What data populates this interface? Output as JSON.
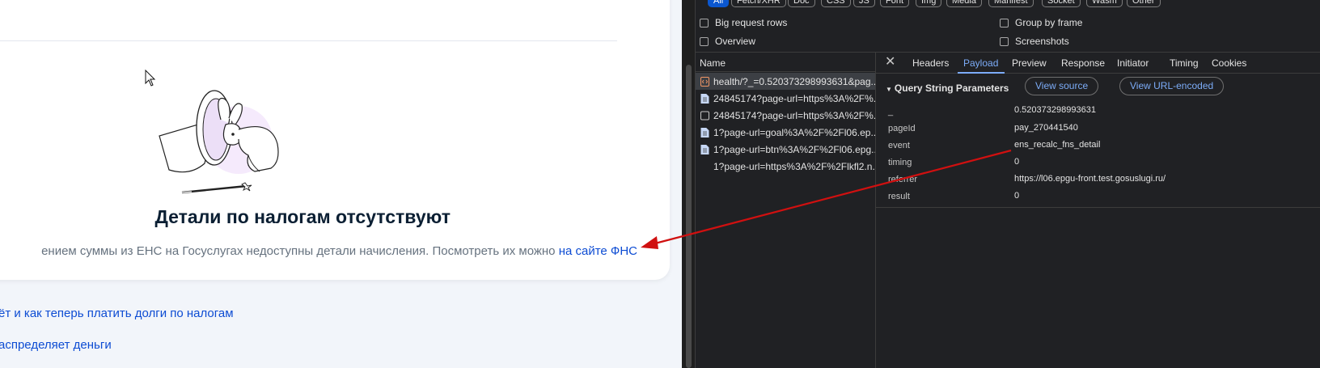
{
  "webpage": {
    "empty_state": {
      "title": "Детали по налогам отсутствуют",
      "description": "ением суммы из ЕНС на Госуслугах недоступны детали начисления. Посмотреть их можно",
      "link_text": "на сайте ФНС"
    },
    "links": [
      "ёт и как теперь платить долги по налогам",
      "аспределяет деньги"
    ]
  },
  "devtools": {
    "filter_chips": [
      "All",
      "Fetch/XHR",
      "Doc",
      "CSS",
      "JS",
      "Font",
      "Img",
      "Media",
      "Manifest",
      "Socket",
      "Wasm",
      "Other"
    ],
    "options": {
      "big_request_rows": "Big request rows",
      "group_by_frame": "Group by frame",
      "overview": "Overview",
      "screenshots": "Screenshots"
    },
    "request_list": {
      "header": "Name",
      "rows": [
        {
          "name": "health/?_=0.520373298993631&pag...",
          "icon": "xhr-icon"
        },
        {
          "name": "24845174?page-url=https%3A%2F%...",
          "icon": "document-icon"
        },
        {
          "name": "24845174?page-url=https%3A%2F%...",
          "icon": "checkbox-icon"
        },
        {
          "name": "1?page-url=goal%3A%2F%2Fl06.ep...",
          "icon": "document-icon"
        },
        {
          "name": "1?page-url=btn%3A%2F%2Fl06.epg...",
          "icon": "document-icon"
        },
        {
          "name": "1?page-url=https%3A%2F%2Flkfl2.n...",
          "icon": "none"
        }
      ]
    },
    "detail_tabs": [
      "Headers",
      "Payload",
      "Preview",
      "Response",
      "Initiator",
      "Timing",
      "Cookies"
    ],
    "active_tab": "Payload",
    "query_string": {
      "title": "Query String Parameters",
      "view_source_label": "View source",
      "view_url_encoded_label": "View URL-encoded",
      "params": [
        {
          "key": "_",
          "value": "0.520373298993631"
        },
        {
          "key": "pageId",
          "value": "pay_270441540"
        },
        {
          "key": "event",
          "value": "ens_recalc_fns_detail"
        },
        {
          "key": "timing",
          "value": "0"
        },
        {
          "key": "referrer",
          "value": "https://l06.epgu-front.test.gosuslugi.ru/"
        },
        {
          "key": "result",
          "value": "0"
        }
      ]
    }
  },
  "colors": {
    "link_blue": "#0d4cd3",
    "devtools_bg": "#202124",
    "active_tab": "#7cacf8",
    "annotation_arrow": "#d01010"
  }
}
